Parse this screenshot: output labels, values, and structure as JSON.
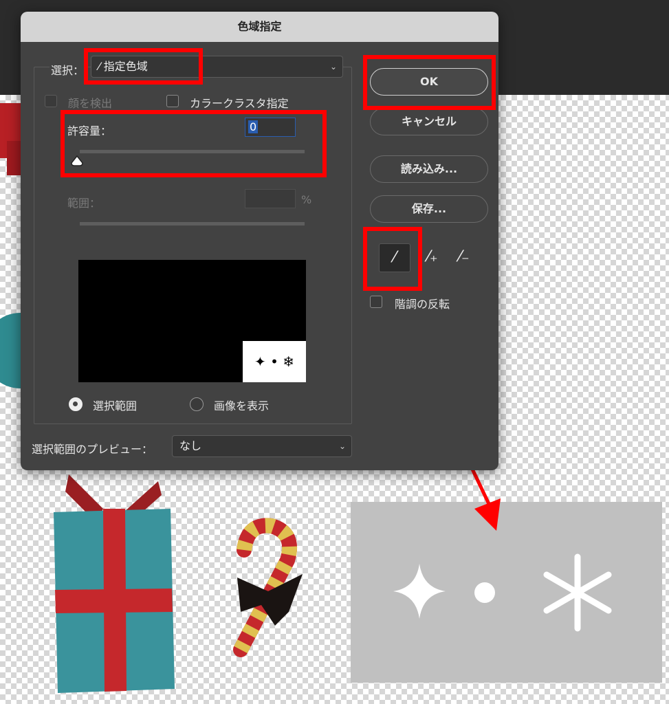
{
  "dialog": {
    "title": "色域指定",
    "select_label": "選択：",
    "select_value": "指定色域",
    "detect_faces": "顔を検出",
    "color_cluster": "カラークラスタ指定",
    "fuzziness_label": "許容量：",
    "fuzziness_value": "0",
    "range_label": "範囲：",
    "range_value": "",
    "range_unit": "%",
    "radio_selection": "選択範囲",
    "radio_image": "画像を表示",
    "preview_label": "選択範囲のプレビュー：",
    "preview_value": "なし",
    "invert_label": "階調の反転",
    "buttons": {
      "ok": "OK",
      "cancel": "キャンセル",
      "load": "読み込み...",
      "save": "保存..."
    },
    "tools": [
      "eyedropper-icon",
      "eyedropper-plus-icon",
      "eyedropper-minus-icon"
    ]
  },
  "colors": {
    "annotation": "#ff0000",
    "dialog_bg": "#424242",
    "titlebar": "#d4d4d4",
    "selection_highlight": "#2a5db0"
  }
}
